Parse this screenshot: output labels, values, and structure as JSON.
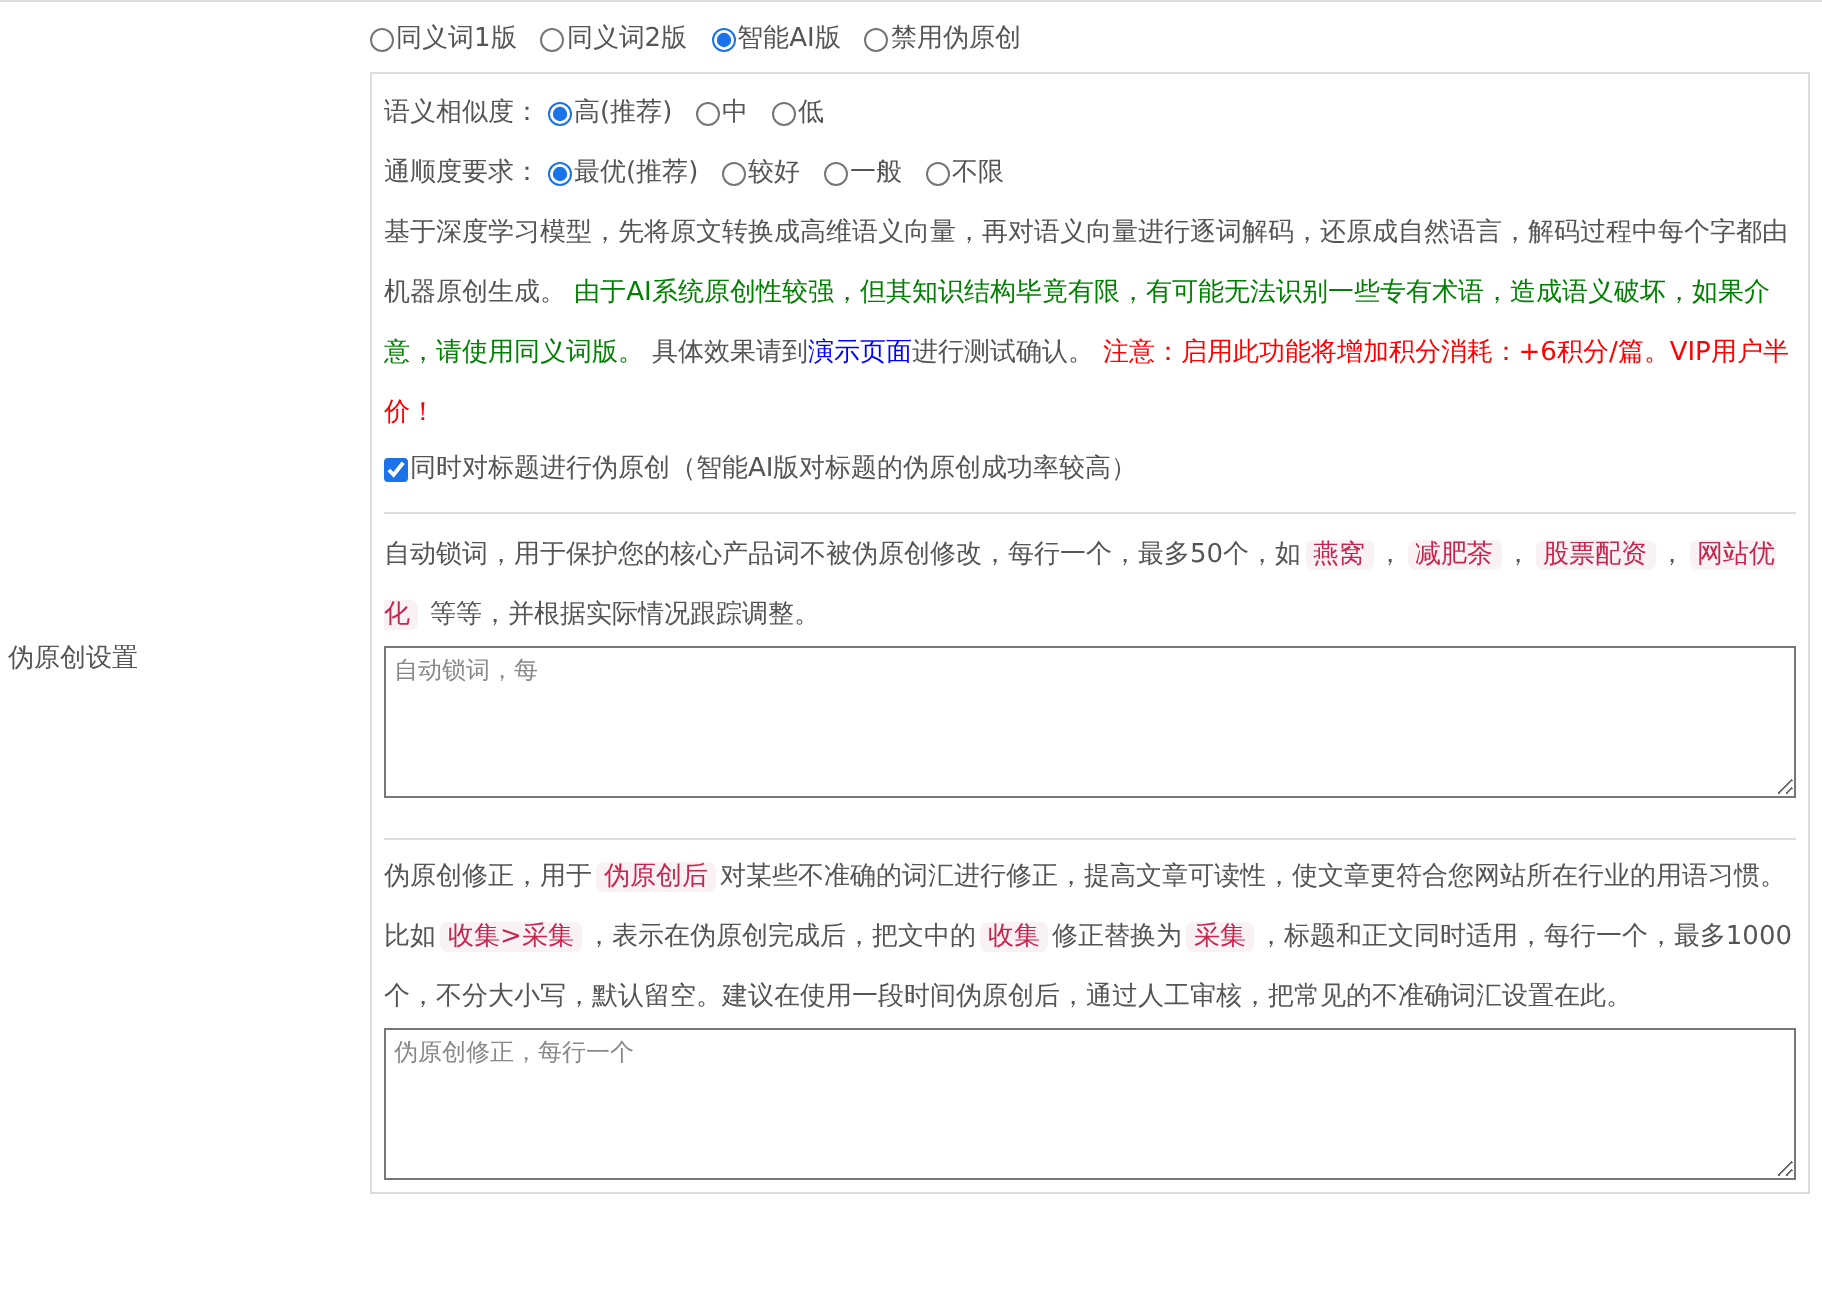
{
  "section_label": "伪原创设置",
  "modes": [
    {
      "label": "同义词1版",
      "selected": false
    },
    {
      "label": "同义词2版",
      "selected": false
    },
    {
      "label": "智能AI版",
      "selected": true
    },
    {
      "label": "禁用伪原创",
      "selected": false
    }
  ],
  "ai_settings": {
    "similarity": {
      "label": "语义相似度：",
      "options": [
        {
          "label": "高(推荐)",
          "selected": true
        },
        {
          "label": "中",
          "selected": false
        },
        {
          "label": "低",
          "selected": false
        }
      ]
    },
    "fluency": {
      "label": "通顺度要求：",
      "options": [
        {
          "label": "最优(推荐)",
          "selected": true
        },
        {
          "label": "较好",
          "selected": false
        },
        {
          "label": "一般",
          "selected": false
        },
        {
          "label": "不限",
          "selected": false
        }
      ]
    },
    "description": [
      {
        "kind": "plain",
        "text": "基于深度学习模型，先将原文转换成高维语义向量，再对语义向量进行逐词解码，还原成自然语言，解码过程中每个字都由机器原创生成。 "
      },
      {
        "kind": "green",
        "text": "由于AI系统原创性较强，但其知识结构毕竟有限，有可能无法识别一些专有术语，造成语义破坏，如果介意，请使用同义词版。"
      },
      {
        "kind": "plain",
        "text": " 具体效果请到"
      },
      {
        "kind": "link",
        "text": "演示页面"
      },
      {
        "kind": "plain",
        "text": "进行测试确认。 "
      },
      {
        "kind": "red",
        "text": "注意：启用此功能将增加积分消耗：+6积分/篇。VIP用户半价！"
      }
    ],
    "title_option": {
      "label": "同时对标题进行伪原创（智能AI版对标题的伪原创成功率较高）",
      "checked": true
    }
  },
  "lock_words": {
    "description": [
      {
        "kind": "plain",
        "text": "自动锁词，用于保护您的核心产品词不被伪原创修改，每行一个，最多50个，如"
      },
      {
        "kind": "tag",
        "text": "燕窝"
      },
      {
        "kind": "plain",
        "text": "，"
      },
      {
        "kind": "tag",
        "text": "减肥茶"
      },
      {
        "kind": "plain",
        "text": "，"
      },
      {
        "kind": "tag",
        "text": "股票配资"
      },
      {
        "kind": "plain",
        "text": "，"
      },
      {
        "kind": "tag",
        "text": "网站优化"
      },
      {
        "kind": "plain",
        "text": " 等等，并根据实际情况跟踪调整。"
      }
    ],
    "placeholder": "自动锁词，每"
  },
  "corrections": {
    "description": [
      {
        "kind": "plain",
        "text": "伪原创修正，用于"
      },
      {
        "kind": "tag",
        "text": "伪原创后"
      },
      {
        "kind": "plain",
        "text": "对某些不准确的词汇进行修正，提高文章可读性，使文章更符合您网站所在行业的用语习惯。比如"
      },
      {
        "kind": "tag",
        "text": "收集>采集"
      },
      {
        "kind": "plain",
        "text": "，表示在伪原创完成后，把文中的"
      },
      {
        "kind": "tag",
        "text": "收集"
      },
      {
        "kind": "plain",
        "text": "修正替换为"
      },
      {
        "kind": "tag",
        "text": "采集"
      },
      {
        "kind": "plain",
        "text": "，标题和正文同时适用，每行一个，最多1000个，不分大小写，默认留空。建议在使用一段时间伪原创后，通过人工审核，把常见的不准确词汇设置在此。"
      }
    ],
    "placeholder": "伪原创修正，每行一个"
  }
}
